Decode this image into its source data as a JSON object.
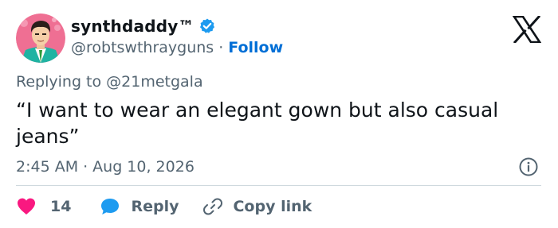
{
  "author": {
    "display_name": "synthdaddy™",
    "handle": "@robtswthrayguns",
    "separator": "·",
    "follow_label": "Follow",
    "avatar_icon": "comic-portrait-avatar",
    "verified_icon": "verified-badge-icon"
  },
  "platform": {
    "logo_icon": "x-logo-icon"
  },
  "tweet": {
    "replying_to_prefix": "Replying to ",
    "replying_to_handle": "@21metgala",
    "text": "“I want to wear an elegant gown but also casual jeans”",
    "time": "2:45 AM",
    "separator": "·",
    "date": "Aug 10, 2026"
  },
  "actions": {
    "like_count": "14",
    "reply_label": "Reply",
    "copy_link_label": "Copy link"
  },
  "colors": {
    "accent_blue": "#1d9bf0",
    "follow_blue": "#006fd6",
    "like_red": "#f91880",
    "muted_gray": "#536471",
    "text_dark": "#0f1419",
    "divider": "#cfd9de"
  }
}
